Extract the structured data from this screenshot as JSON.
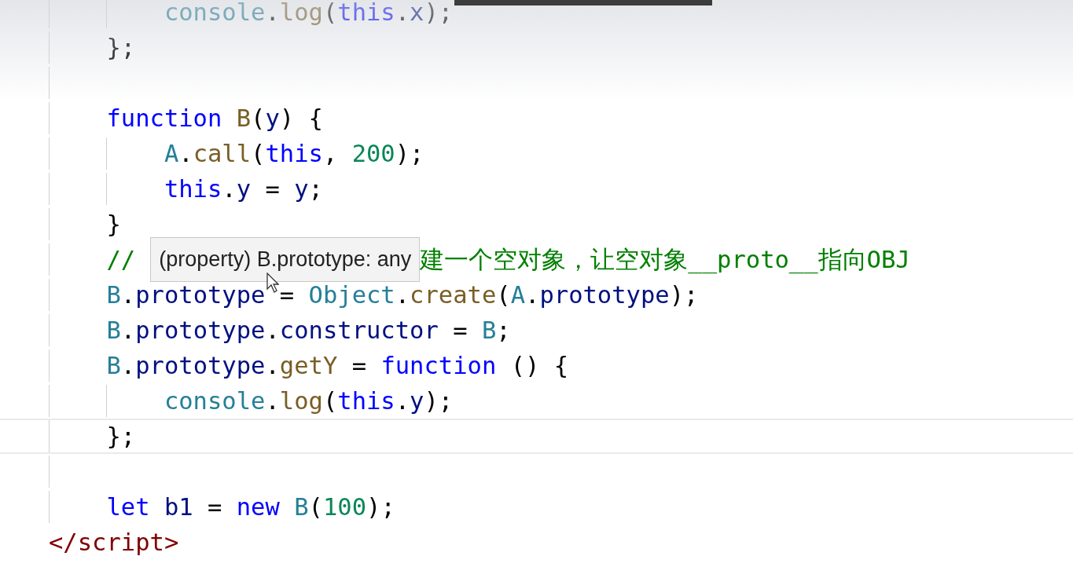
{
  "top_lines": [
    {
      "current": false,
      "tokens": [
        {
          "kind": "type",
          "text": "console"
        },
        {
          "kind": "plain",
          "text": "."
        },
        {
          "kind": "method",
          "text": "log"
        },
        {
          "kind": "plain",
          "text": "("
        },
        {
          "kind": "keyword",
          "text": "this"
        },
        {
          "kind": "plain",
          "text": "."
        },
        {
          "kind": "prop",
          "text": "x"
        },
        {
          "kind": "plain",
          "text": ");"
        }
      ]
    }
  ],
  "script_body": [
    {
      "current": false,
      "tokens": [
        {
          "kind": "plain",
          "text": "};"
        }
      ]
    },
    {
      "current": false
    },
    {
      "current": false,
      "tokens": [
        {
          "kind": "keyword",
          "text": "function "
        },
        {
          "kind": "method",
          "text": "B"
        },
        {
          "kind": "plain",
          "text": "("
        },
        {
          "kind": "prop",
          "text": "y"
        },
        {
          "kind": "plain",
          "text": ") {"
        }
      ],
      "children": [
        {
          "current": false,
          "tokens": [
            {
              "kind": "type",
              "text": "A"
            },
            {
              "kind": "plain",
              "text": "."
            },
            {
              "kind": "method",
              "text": "call"
            },
            {
              "kind": "plain",
              "text": "("
            },
            {
              "kind": "keyword",
              "text": "this"
            },
            {
              "kind": "plain",
              "text": ", "
            },
            {
              "kind": "number",
              "text": "200"
            },
            {
              "kind": "plain",
              "text": ");"
            }
          ]
        },
        {
          "current": false,
          "tokens": [
            {
              "kind": "keyword",
              "text": "this"
            },
            {
              "kind": "plain",
              "text": "."
            },
            {
              "kind": "prop",
              "text": "y"
            },
            {
              "kind": "plain",
              "text": " = "
            },
            {
              "kind": "prop",
              "text": "y"
            },
            {
              "kind": "plain",
              "text": ";"
            }
          ]
        }
      ]
    },
    {
      "current": false,
      "tokens": [
        {
          "kind": "plain",
          "text": "}"
        }
      ]
    },
    {
      "current": false,
      "tokens": [
        {
          "kind": "comment",
          "text": "//"
        },
        {
          "kind": "tooltip",
          "text": "(property) B.prototype: any"
        },
        {
          "kind": "comment",
          "text": "建一个空对象，让空对象__proto__指向OBJ"
        }
      ]
    },
    {
      "current": false,
      "tokens": [
        {
          "kind": "type",
          "text": "B"
        },
        {
          "kind": "plain",
          "text": "."
        },
        {
          "kind": "prop",
          "text": "prototype"
        },
        {
          "kind": "cursor"
        },
        {
          "kind": "plain",
          "text": "= "
        },
        {
          "kind": "type",
          "text": "Object"
        },
        {
          "kind": "plain",
          "text": "."
        },
        {
          "kind": "method",
          "text": "create"
        },
        {
          "kind": "plain",
          "text": "("
        },
        {
          "kind": "type",
          "text": "A"
        },
        {
          "kind": "plain",
          "text": "."
        },
        {
          "kind": "prop",
          "text": "prototype"
        },
        {
          "kind": "plain",
          "text": ");"
        }
      ]
    },
    {
      "current": false,
      "tokens": [
        {
          "kind": "type",
          "text": "B"
        },
        {
          "kind": "plain",
          "text": "."
        },
        {
          "kind": "prop",
          "text": "prototype"
        },
        {
          "kind": "plain",
          "text": "."
        },
        {
          "kind": "prop",
          "text": "constructor"
        },
        {
          "kind": "plain",
          "text": " = "
        },
        {
          "kind": "type",
          "text": "B"
        },
        {
          "kind": "plain",
          "text": ";"
        }
      ]
    },
    {
      "current": false,
      "tokens": [
        {
          "kind": "type",
          "text": "B"
        },
        {
          "kind": "plain",
          "text": "."
        },
        {
          "kind": "prop",
          "text": "prototype"
        },
        {
          "kind": "plain",
          "text": "."
        },
        {
          "kind": "method",
          "text": "getY"
        },
        {
          "kind": "plain",
          "text": " = "
        },
        {
          "kind": "keyword",
          "text": "function"
        },
        {
          "kind": "plain",
          "text": " () {"
        }
      ],
      "children": [
        {
          "current": false,
          "tokens": [
            {
              "kind": "type",
              "text": "console"
            },
            {
              "kind": "plain",
              "text": "."
            },
            {
              "kind": "method",
              "text": "log"
            },
            {
              "kind": "plain",
              "text": "("
            },
            {
              "kind": "keyword",
              "text": "this"
            },
            {
              "kind": "plain",
              "text": "."
            },
            {
              "kind": "prop",
              "text": "y"
            },
            {
              "kind": "plain",
              "text": ");"
            }
          ]
        }
      ]
    },
    {
      "current": true,
      "tokens": [
        {
          "kind": "plain",
          "text": "};"
        }
      ]
    },
    {
      "current": false
    },
    {
      "current": false,
      "tokens": [
        {
          "kind": "keyword",
          "text": "let "
        },
        {
          "kind": "prop",
          "text": "b1"
        },
        {
          "kind": "plain",
          "text": " = "
        },
        {
          "kind": "keyword",
          "text": "new "
        },
        {
          "kind": "type",
          "text": "B"
        },
        {
          "kind": "plain",
          "text": "("
        },
        {
          "kind": "number",
          "text": "100"
        },
        {
          "kind": "plain",
          "text": ");"
        }
      ]
    }
  ],
  "closing_tag": {
    "text": "</script>"
  }
}
